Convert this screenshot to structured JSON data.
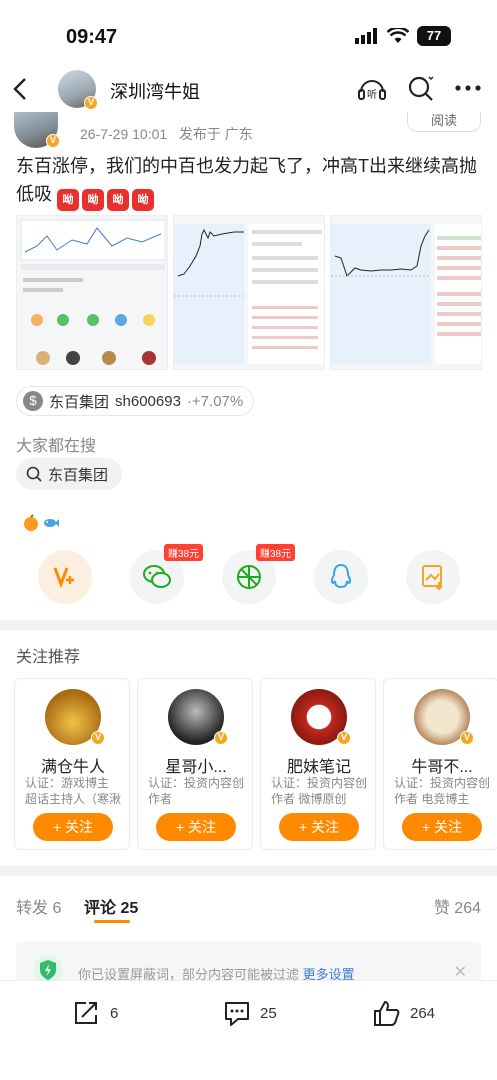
{
  "status_bar": {
    "time": "09:47",
    "battery": "77"
  },
  "nav": {
    "title": "深圳湾牛姐"
  },
  "post": {
    "time": "26-7-29 10:01",
    "location": "发布于 广东",
    "read_label": "阅读",
    "text": "东百涨停，我们的中百也发力起飞了，冲高T出来继续高抛低吸",
    "emoji_text": "呦",
    "emoji_count": 4
  },
  "stock_tag": {
    "name": "东百集团",
    "code": "sh600693",
    "change": "+7.07%",
    "icon": "dollar-icon"
  },
  "search": {
    "title": "大家都在搜",
    "chip": "东百集团"
  },
  "share": {
    "badge_1": "赚38元",
    "badge_2": "赚38元"
  },
  "recommend": {
    "title": "关注推荐",
    "follow_label": "+ 关注",
    "cards": [
      {
        "name": "满仓牛人",
        "desc": "认证：游戏博主 超话主持人（寒湫超..."
      },
      {
        "name": "星哥小...",
        "desc": "认证：投资内容创作者"
      },
      {
        "name": "肥妹笔记",
        "desc": "认证：投资内容创作者 微博原创视..."
      },
      {
        "name": "牛哥不...",
        "desc": "认证：投资内容创作者 电竞博主"
      }
    ]
  },
  "tabs": {
    "repost": "转发 6",
    "comment": "评论 25",
    "likes": "赞 264"
  },
  "filter": {
    "text": "你已设置屏蔽词，部分内容可能被过滤",
    "link": "更多设置"
  },
  "bottom_bar": {
    "share_count": "6",
    "comment_count": "25",
    "like_count": "264"
  }
}
